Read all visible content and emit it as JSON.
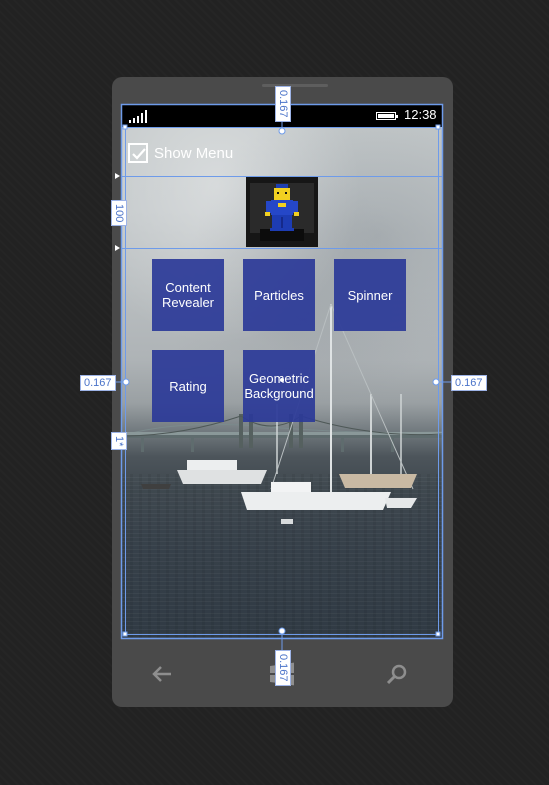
{
  "status_bar": {
    "time": "12:38",
    "icons": [
      "signal-strength-icon",
      "battery-icon"
    ]
  },
  "show_menu": {
    "label": "Show Menu",
    "checked": true
  },
  "header_image": {
    "description_icon": "lego-figure-photo"
  },
  "tiles": [
    {
      "label": "Content Revealer"
    },
    {
      "label": "Particles"
    },
    {
      "label": "Spinner"
    },
    {
      "label": "Rating"
    },
    {
      "label": "Geometric Background"
    }
  ],
  "nav_bar": {
    "icons": [
      "back-arrow-icon",
      "windows-start-icon",
      "search-icon"
    ]
  },
  "designer_overlay": {
    "margin_top": "0.167",
    "margin_bottom": "0.167",
    "margin_left": "0.167",
    "margin_right": "0.167",
    "row_height_label": "100",
    "small_label": "1*"
  },
  "colors": {
    "tile_background": "#2b3a98",
    "selection_outline": "#6e9bea",
    "status_bar": "#000000",
    "phone_body": "#4a4a4a"
  }
}
